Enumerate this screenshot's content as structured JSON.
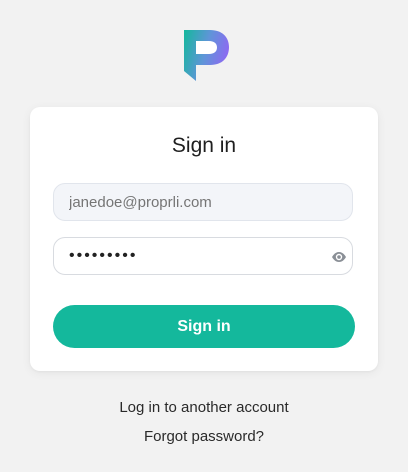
{
  "brand": {
    "logo_icon": "proprli-p-logo-icon",
    "colors": {
      "logo_left": "#14b89c",
      "logo_right": "#8a6cf0",
      "accent": "#14b89c"
    }
  },
  "signin": {
    "title": "Sign in",
    "email_placeholder": "janedoe@proprli.com",
    "email_value": "",
    "password_value": "•••••••••",
    "show_password_icon": "eye-icon",
    "submit_label": "Sign in"
  },
  "links": {
    "other_account": "Log in to another account",
    "forgot_password": "Forgot password?"
  }
}
